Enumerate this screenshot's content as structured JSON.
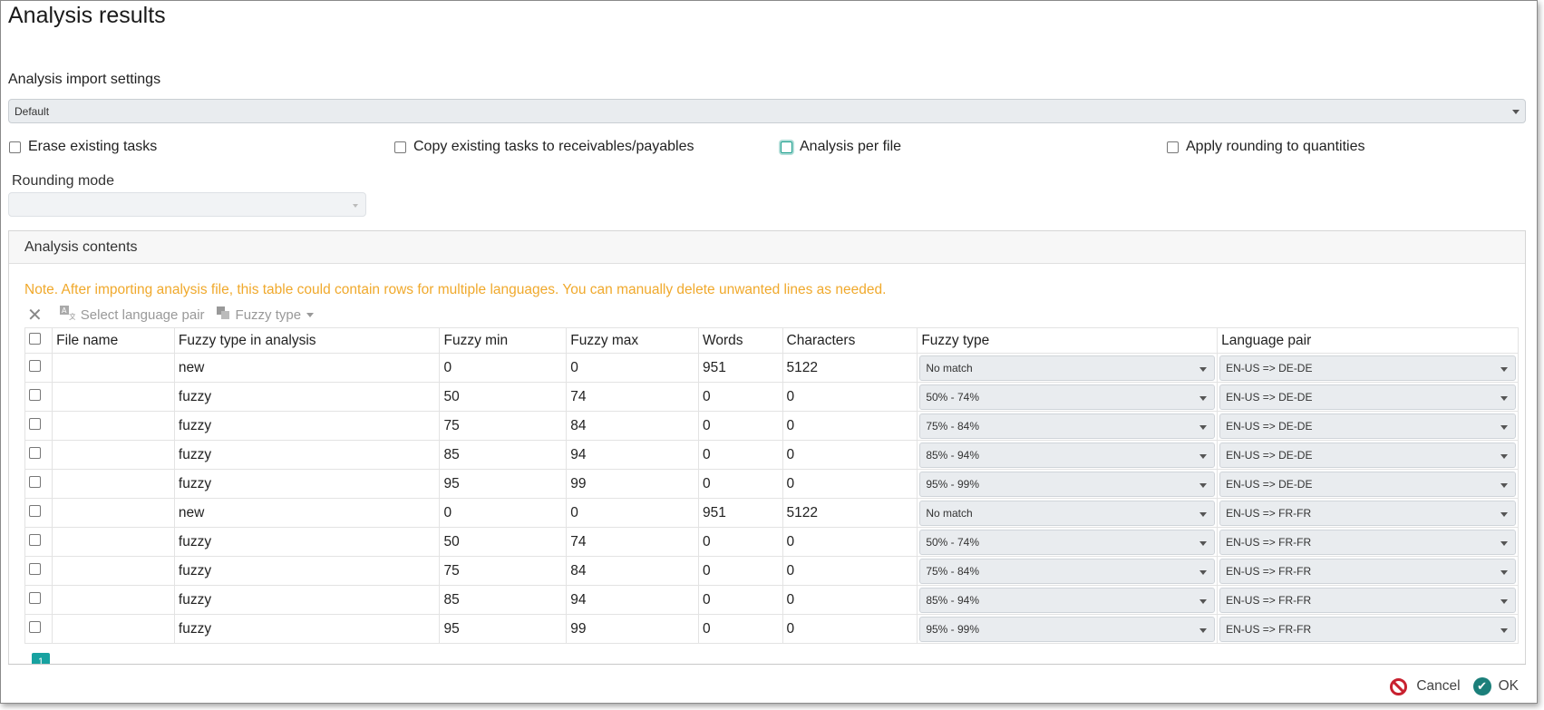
{
  "title": "Analysis results",
  "import_settings": {
    "label": "Analysis import settings",
    "selected": "Default"
  },
  "options": {
    "erase": "Erase existing tasks",
    "copy": "Copy existing tasks to receivables/payables",
    "per_file": "Analysis per file",
    "rounding": "Apply rounding to quantities"
  },
  "rounding_mode": {
    "label": "Rounding mode",
    "selected": ""
  },
  "contents": {
    "header": "Analysis contents",
    "note": "Note. After importing analysis file, this table could contain rows for multiple languages. You can manually delete unwanted lines as needed.",
    "toolbar": {
      "select_language_pair": "Select language pair",
      "fuzzy_type": "Fuzzy type"
    },
    "columns": [
      "File name",
      "Fuzzy type in analysis",
      "Fuzzy min",
      "Fuzzy max",
      "Words",
      "Characters",
      "Fuzzy type",
      "Language pair"
    ],
    "rows": [
      {
        "file": "",
        "type": "new",
        "min": "0",
        "max": "0",
        "words": "951",
        "chars": "5122",
        "fuzzy": "No match",
        "pair": "EN-US => DE-DE"
      },
      {
        "file": "",
        "type": "fuzzy",
        "min": "50",
        "max": "74",
        "words": "0",
        "chars": "0",
        "fuzzy": "50% - 74%",
        "pair": "EN-US => DE-DE"
      },
      {
        "file": "",
        "type": "fuzzy",
        "min": "75",
        "max": "84",
        "words": "0",
        "chars": "0",
        "fuzzy": "75% - 84%",
        "pair": "EN-US => DE-DE"
      },
      {
        "file": "",
        "type": "fuzzy",
        "min": "85",
        "max": "94",
        "words": "0",
        "chars": "0",
        "fuzzy": "85% - 94%",
        "pair": "EN-US => DE-DE"
      },
      {
        "file": "",
        "type": "fuzzy",
        "min": "95",
        "max": "99",
        "words": "0",
        "chars": "0",
        "fuzzy": "95% - 99%",
        "pair": "EN-US => DE-DE"
      },
      {
        "file": "",
        "type": "new",
        "min": "0",
        "max": "0",
        "words": "951",
        "chars": "5122",
        "fuzzy": "No match",
        "pair": "EN-US => FR-FR"
      },
      {
        "file": "",
        "type": "fuzzy",
        "min": "50",
        "max": "74",
        "words": "0",
        "chars": "0",
        "fuzzy": "50% - 74%",
        "pair": "EN-US => FR-FR"
      },
      {
        "file": "",
        "type": "fuzzy",
        "min": "75",
        "max": "84",
        "words": "0",
        "chars": "0",
        "fuzzy": "75% - 84%",
        "pair": "EN-US => FR-FR"
      },
      {
        "file": "",
        "type": "fuzzy",
        "min": "85",
        "max": "94",
        "words": "0",
        "chars": "0",
        "fuzzy": "85% - 94%",
        "pair": "EN-US => FR-FR"
      },
      {
        "file": "",
        "type": "fuzzy",
        "min": "95",
        "max": "99",
        "words": "0",
        "chars": "0",
        "fuzzy": "95% - 99%",
        "pair": "EN-US => FR-FR"
      }
    ],
    "page": "1"
  },
  "footer": {
    "cancel": "Cancel",
    "ok": "OK"
  },
  "colors": {
    "accent": "#17a2a0",
    "note": "#f0a92c",
    "cancel": "#c8212f",
    "ok": "#1b7f7a"
  }
}
